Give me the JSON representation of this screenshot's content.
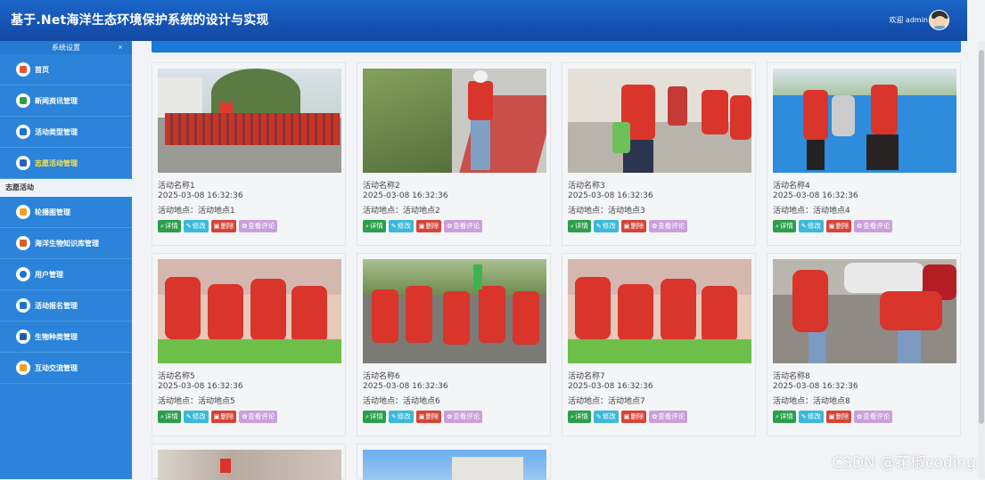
{
  "header": {
    "title": "基于.Net海洋生态环境保护系统的设计与实现",
    "welcome": "欢迎 admin"
  },
  "sidebar": {
    "section_title": "系统设置",
    "collapse_icon": "×",
    "items": [
      {
        "label": "首页",
        "icon": "home-icon"
      },
      {
        "label": "新闻资讯管理",
        "icon": "news-icon"
      },
      {
        "label": "活动类型管理",
        "icon": "category-icon"
      },
      {
        "label": "志愿活动管理",
        "icon": "volunteer-icon",
        "active": true
      },
      {
        "label": "轮播图管理",
        "icon": "carousel-icon"
      },
      {
        "label": "海洋生物知识库管理",
        "icon": "knowledge-icon"
      },
      {
        "label": "用户管理",
        "icon": "user-icon"
      },
      {
        "label": "活动报名管理",
        "icon": "signup-icon"
      },
      {
        "label": "生物种类管理",
        "icon": "species-icon"
      },
      {
        "label": "互动交流管理",
        "icon": "chat-icon"
      }
    ],
    "submenu": "志愿活动"
  },
  "buttons": {
    "detail": "详情",
    "edit": "修改",
    "delete": "删除",
    "comments": "查看评论"
  },
  "cards": [
    {
      "name": "活动名称1",
      "time": "2025-03-08 16:32:36",
      "place": "活动地点：活动地点1"
    },
    {
      "name": "活动名称2",
      "time": "2025-03-08 16:32:36",
      "place": "活动地点：活动地点2"
    },
    {
      "name": "活动名称3",
      "time": "2025-03-08 16:32:36",
      "place": "活动地点：活动地点3"
    },
    {
      "name": "活动名称4",
      "time": "2025-03-08 16:32:36",
      "place": "活动地点：活动地点4"
    },
    {
      "name": "活动名称5",
      "time": "2025-03-08 16:32:36",
      "place": "活动地点：活动地点5"
    },
    {
      "name": "活动名称6",
      "time": "2025-03-08 16:32:36",
      "place": "活动地点：活动地点6"
    },
    {
      "name": "活动名称7",
      "time": "2025-03-08 16:32:36",
      "place": "活动地点：活动地点7"
    },
    {
      "name": "活动名称8",
      "time": "2025-03-08 16:32:36",
      "place": "活动地点：活动地点8"
    }
  ],
  "watermark": "CSDN @花椒coding",
  "colors": {
    "header": "#1552b2",
    "sidebar": "#2b84d9",
    "detail": "#2a9f4b",
    "edit": "#3cb9d9",
    "delete": "#d64437",
    "comments": "#c9a0dc"
  }
}
